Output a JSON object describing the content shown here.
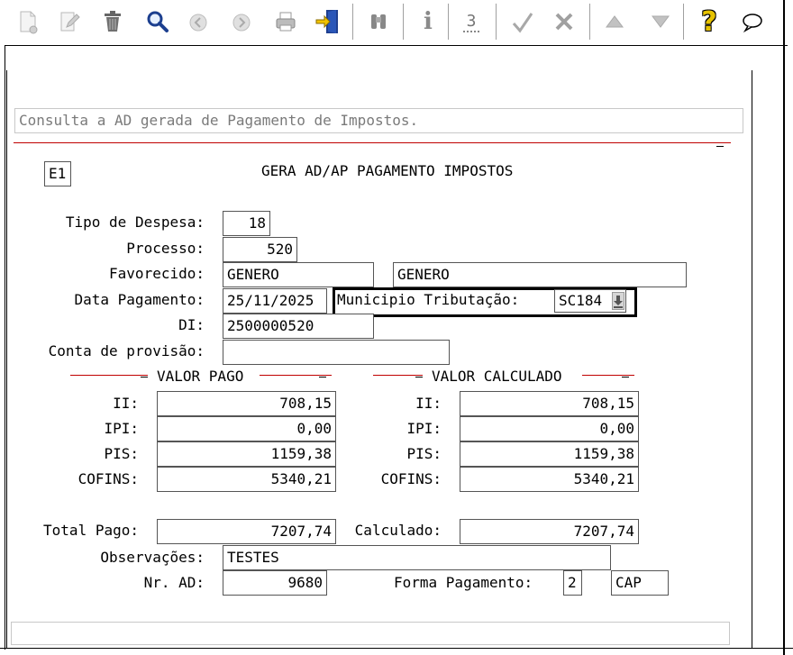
{
  "toolbar": {
    "icons": [
      "new-document-icon",
      "edit-icon",
      "trash-icon",
      "search-icon",
      "previous-icon",
      "next-icon",
      "print-icon",
      "exit-icon",
      "binoculars-icon",
      "info-icon",
      "counter-icon",
      "confirm-icon",
      "cancel-icon",
      "scroll-up-icon",
      "scroll-down-icon",
      "help-icon",
      "chat-icon"
    ],
    "counter_label": "3",
    "info_label": "i",
    "help_label": "?"
  },
  "message": "Consulta a AD gerada de Pagamento de Impostos.",
  "screen_code": "E1",
  "screen_title": "GERA AD/AP PAGAMENTO IMPOSTOS",
  "form": {
    "tipo_despesa_label": "Tipo de Despesa:",
    "tipo_despesa": "18",
    "processo_label": "Processo:",
    "processo": "520",
    "favorecido_label": "Favorecido:",
    "favorecido_1": "GENERO",
    "favorecido_2": "GENERO",
    "data_pagamento_label": "Data Pagamento:",
    "data_pagamento": "25/11/2025",
    "municipio_label": "Municipio Tributação:",
    "municipio": "SC184",
    "di_label": "DI:",
    "di": "2500000520",
    "conta_provisao_label": "Conta de provisão:",
    "conta_provisao": ""
  },
  "valor_pago": {
    "title": "VALOR PAGO",
    "rows": [
      {
        "label": "II:",
        "value": "708,15"
      },
      {
        "label": "IPI:",
        "value": "0,00"
      },
      {
        "label": "PIS:",
        "value": "1159,38"
      },
      {
        "label": "COFINS:",
        "value": "5340,21"
      }
    ]
  },
  "valor_calculado": {
    "title": "VALOR CALCULADO",
    "rows": [
      {
        "label": "II:",
        "value": "708,15"
      },
      {
        "label": "IPI:",
        "value": "0,00"
      },
      {
        "label": "PIS:",
        "value": "1159,38"
      },
      {
        "label": "COFINS:",
        "value": "5340,21"
      }
    ]
  },
  "totals": {
    "total_pago_label": "Total Pago:",
    "total_pago": "7207,74",
    "calculado_label": "Calculado:",
    "calculado": "7207,74",
    "observacoes_label": "Observações:",
    "observacoes": "TESTES",
    "nr_ad_label": "Nr. AD:",
    "nr_ad": "9680",
    "forma_pagamento_label": "Forma Pagamento:",
    "forma_pagamento_code": "2",
    "forma_pagamento_desc": "CAP"
  },
  "status_bar": ""
}
